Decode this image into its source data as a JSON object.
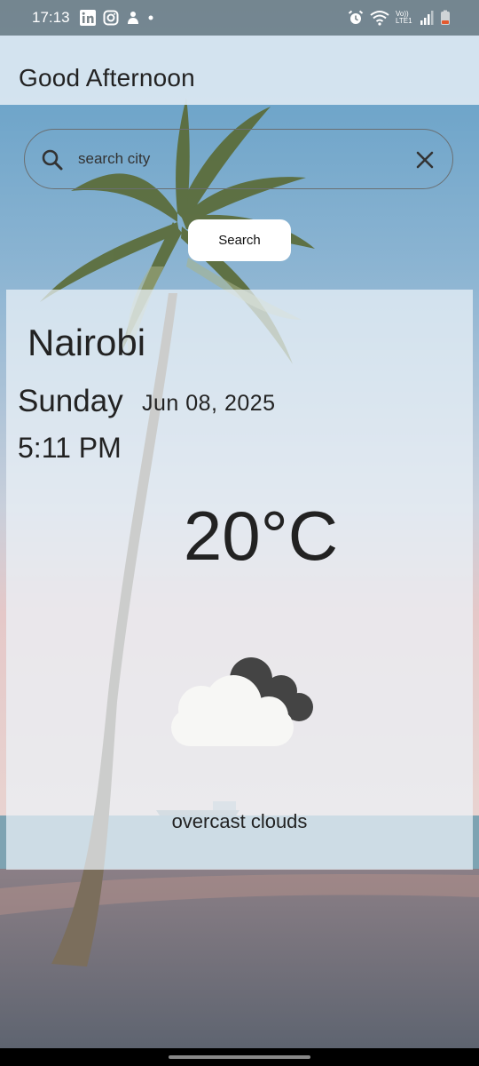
{
  "status_bar": {
    "time": "17:13",
    "left_icons": [
      "linkedin-icon",
      "instagram-icon",
      "app-notification-icon",
      "dot-icon"
    ],
    "right_icons": [
      "alarm-icon",
      "wifi-icon",
      "volte-icon",
      "signal-icon",
      "battery-low-icon"
    ],
    "volte_text": "Vo)) LTE1"
  },
  "app_bar": {
    "title": "Good Afternoon"
  },
  "search": {
    "placeholder": "search city",
    "value": "",
    "button_label": "Search"
  },
  "weather": {
    "city": "Nairobi",
    "day": "Sunday",
    "date": "Jun 08, 2025",
    "time": "5:11 PM",
    "temperature": "20°C",
    "condition": "overcast clouds",
    "icon": "overcast-clouds-icon"
  },
  "colors": {
    "card_bg": "#ECF2F8",
    "text": "#222222",
    "dark_cloud": "#444444"
  }
}
